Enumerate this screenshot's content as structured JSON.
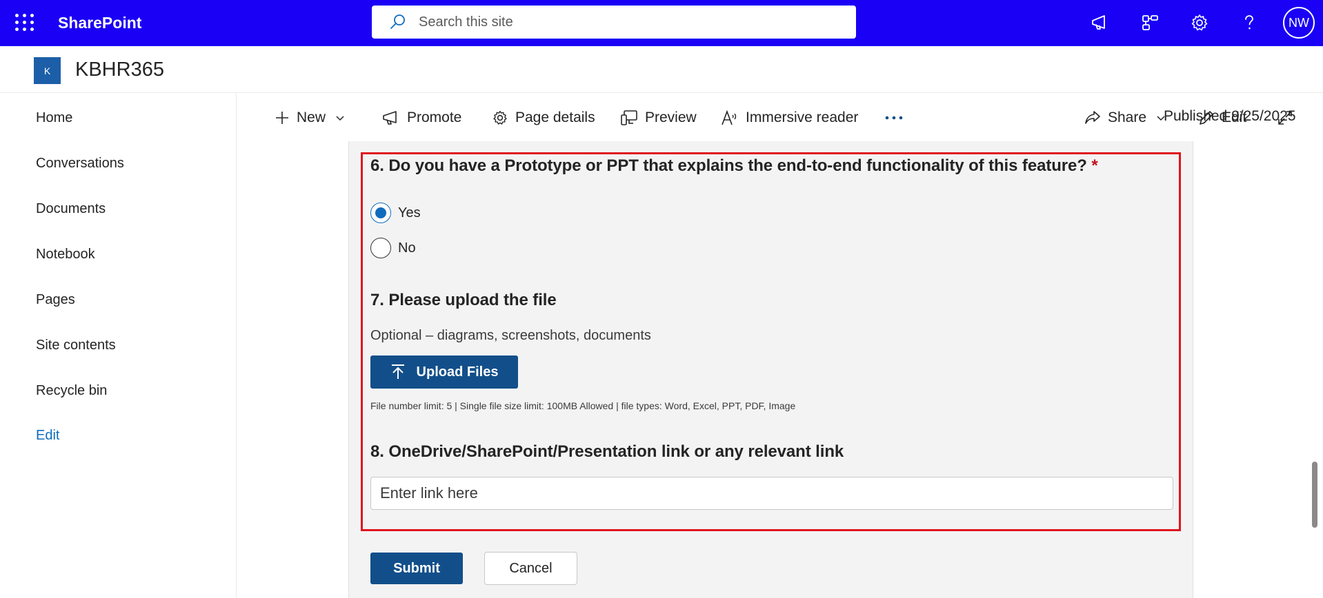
{
  "suite": {
    "brand": "SharePoint",
    "search_placeholder": "Search this site",
    "icons": [
      "megaphone-icon",
      "org-chart-icon",
      "gear-icon",
      "help-icon"
    ],
    "avatar_initials": "NW"
  },
  "site": {
    "logo_letter": "K",
    "title": "KBHR365"
  },
  "leftnav": {
    "items": [
      {
        "label": "Home"
      },
      {
        "label": "Conversations"
      },
      {
        "label": "Documents"
      },
      {
        "label": "Notebook"
      },
      {
        "label": "Pages"
      },
      {
        "label": "Site contents"
      },
      {
        "label": "Recycle bin"
      },
      {
        "label": "Edit"
      }
    ]
  },
  "commandbar": {
    "new": "New",
    "promote": "Promote",
    "page_details": "Page details",
    "preview": "Preview",
    "immersive_reader": "Immersive reader",
    "published": "Published 9/25/2025",
    "share": "Share",
    "edit": "Edit"
  },
  "form": {
    "q6": {
      "title": "6. Do you have a Prototype or PPT that explains the end-to-end functionality of this feature?",
      "required_mark": "*",
      "options": [
        {
          "label": "Yes",
          "selected": true
        },
        {
          "label": "No",
          "selected": false
        }
      ]
    },
    "q7": {
      "title": "7. Please upload the file",
      "helper": "Optional – diagrams, screenshots, documents",
      "upload_label": "Upload Files",
      "limits": "File number limit: 5 | Single file size limit: 100MB Allowed | file types: Word, Excel, PPT, PDF, Image"
    },
    "q8": {
      "title": "8. OneDrive/SharePoint/Presentation link or any relevant link",
      "placeholder": "Enter link here"
    },
    "submit_label": "Submit",
    "cancel_label": "Cancel"
  },
  "colors": {
    "suite_bar": "#1a00f5",
    "primary_button": "#124f8a",
    "highlight_border": "#e0141e",
    "accent": "#0f6cbd"
  }
}
